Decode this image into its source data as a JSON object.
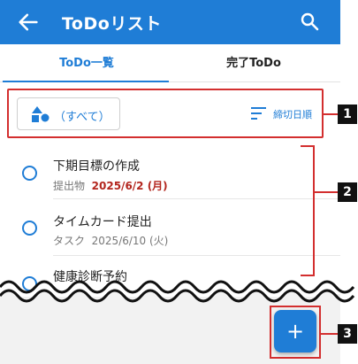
{
  "appbar": {
    "title": "ToDoリスト",
    "back_icon": "arrow-left-icon",
    "search_icon": "search-icon"
  },
  "tabs": [
    {
      "label": "ToDo一覧",
      "active": true
    },
    {
      "label": "完了ToDo",
      "active": false
    }
  ],
  "filter": {
    "label": "（すべて）",
    "icon": "shapes-icon"
  },
  "sort": {
    "label": "締切日順",
    "icon": "sort-icon"
  },
  "items": [
    {
      "name": "下期目標の作成",
      "category": "提出物",
      "due": "2025/6/2 (月)",
      "overdue": true
    },
    {
      "name": "タイムカード提出",
      "category": "タスク",
      "due": "2025/6/10 (火)",
      "overdue": false
    },
    {
      "name": "健康診断予約",
      "category": "",
      "due": "",
      "overdue": false
    }
  ],
  "fab": {
    "label": "+",
    "icon": "plus-icon"
  },
  "callouts": [
    "1",
    "2",
    "3"
  ],
  "colors": {
    "primary": "#1f7dd6",
    "overdue": "#b3261e",
    "callout": "#d32f2f"
  }
}
